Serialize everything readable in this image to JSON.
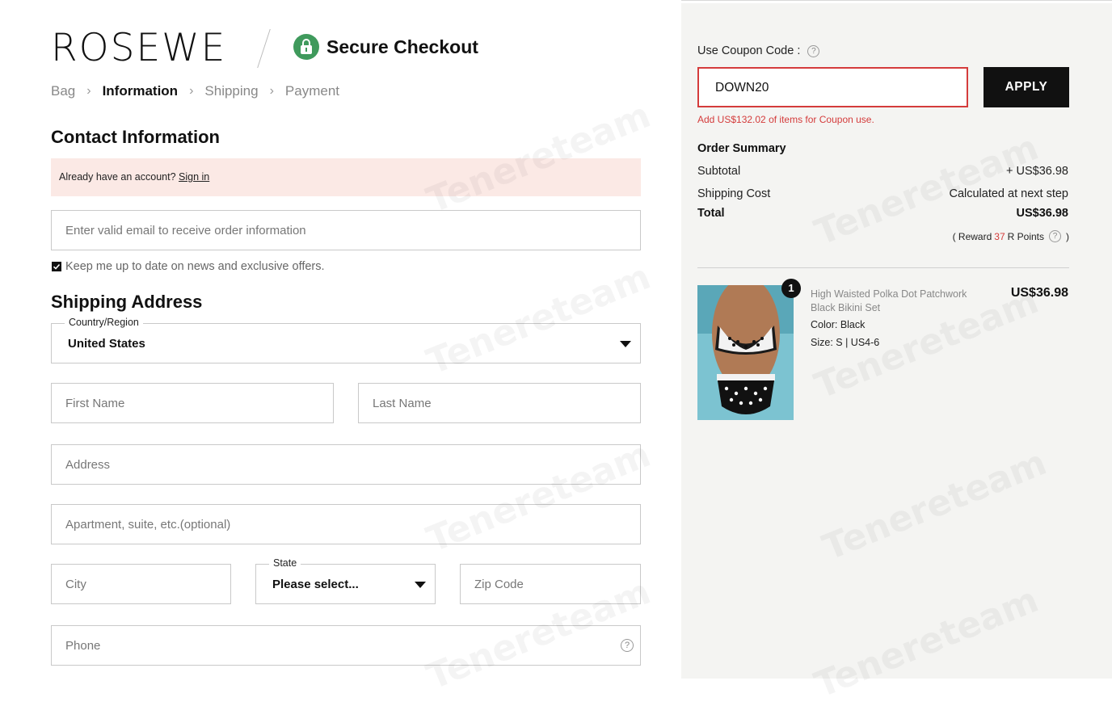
{
  "header": {
    "brand": "ROSEWE",
    "secure_title": "Secure Checkout"
  },
  "breadcrumb": {
    "items": [
      {
        "label": "Bag",
        "active": false
      },
      {
        "label": "Information",
        "active": true
      },
      {
        "label": "Shipping",
        "active": false
      },
      {
        "label": "Payment",
        "active": false
      }
    ]
  },
  "contact": {
    "title": "Contact Information",
    "account_prompt": "Already have an account?",
    "sign_in": "Sign in",
    "email_placeholder": "Enter valid email to receive order information",
    "newsletter_label": "Keep me up to date on news and exclusive offers.",
    "newsletter_checked": true
  },
  "shipping": {
    "title": "Shipping Address",
    "country_legend": "Country/Region",
    "country_value": "United States",
    "first_name_placeholder": "First Name",
    "last_name_placeholder": "Last Name",
    "address_placeholder": "Address",
    "apartment_placeholder": "Apartment, suite, etc.(optional)",
    "city_placeholder": "City",
    "state_legend": "State",
    "state_value": "Please select...",
    "zip_placeholder": "Zip Code",
    "phone_placeholder": "Phone",
    "phone_help": "?"
  },
  "coupon": {
    "label": "Use Coupon Code :",
    "help": "?",
    "value": "DOWN20",
    "apply_label": "APPLY",
    "message": "Add US$132.02 of items for Coupon use."
  },
  "summary": {
    "title": "Order Summary",
    "subtotal_label": "Subtotal",
    "subtotal_value": "+ US$36.98",
    "shipping_label": "Shipping Cost",
    "shipping_value": "Calculated at next step",
    "total_label": "Total",
    "total_value": "US$36.98",
    "reward_prefix": "( Reward",
    "reward_points": "37",
    "reward_suffix": "R Points",
    "reward_help": "?",
    "reward_close": ")"
  },
  "product": {
    "quantity": "1",
    "name": "High Waisted Polka Dot Patchwork Black Bikini Set",
    "color": "Color: Black",
    "size": "Size: S | US4-6",
    "price": "US$36.98"
  },
  "watermark": "Tenereteam",
  "colors": {
    "accent_red": "#d43b3b",
    "lock_green": "#3f9a5c",
    "notice_bg": "#fbe9e5",
    "panel_bg": "#f4f4f2"
  }
}
